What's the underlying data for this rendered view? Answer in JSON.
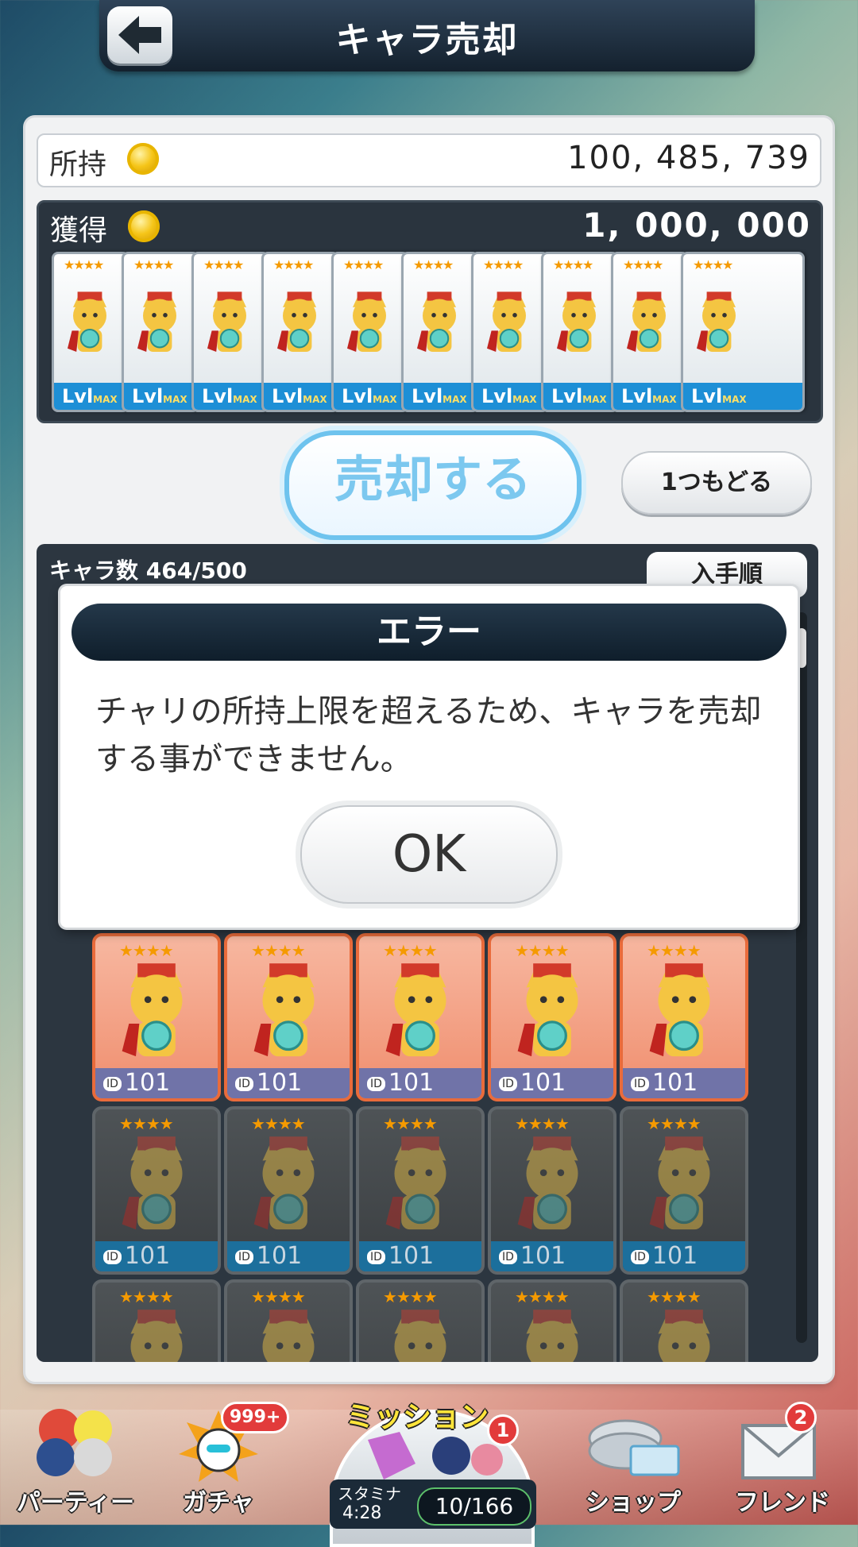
{
  "header": {
    "title": "キャラ売却",
    "back_label": "back"
  },
  "owned": {
    "label": "所持",
    "value": "100, 485, 739"
  },
  "gain": {
    "label": "獲得",
    "value": "1, 000, 000"
  },
  "gain_cards": {
    "count": 10,
    "level_label": "Lvl",
    "max_label": "MAX"
  },
  "actions": {
    "sell_label": "売却する",
    "undo_label": "1つもどる"
  },
  "list": {
    "count_label": "キャラ数 464/500",
    "sort_label": "入手順",
    "id_prefix": "ID",
    "id_value": "101"
  },
  "dialog": {
    "title": "エラー",
    "message": "チャリの所持上限を超えるため、キャラを売却する事ができません。",
    "ok_label": "OK"
  },
  "nav": {
    "party_label": "パーティー",
    "gacha_label": "ガチャ",
    "gacha_badge": "999+",
    "mission_label": "ミッション",
    "mission_badge": "1",
    "stamina_label": "スタミナ",
    "stamina_timer": "4:28",
    "stamina_value": "10/166",
    "shop_label": "ショップ",
    "friend_label": "フレンド",
    "friend_badge": "2"
  },
  "colors": {
    "accent": "#6ec3ee",
    "selected_card": "#f08e6e",
    "header": "#14212e"
  }
}
